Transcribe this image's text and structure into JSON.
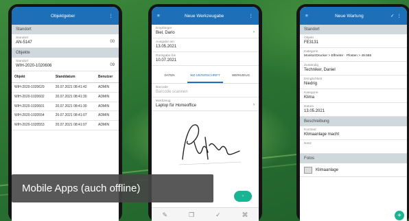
{
  "phone1": {
    "title": "Objektgeber",
    "sections": [
      "Standort",
      "Objekte"
    ],
    "fields": [
      {
        "label": "Standort",
        "value": "AN-5147",
        "right": "00"
      },
      {
        "label": "Standort",
        "value": "WIH-2020-1020606",
        "right": "09"
      }
    ],
    "columns": [
      "Objekt",
      "Standdatum",
      "Benutzer"
    ],
    "rows": [
      [
        "WIH-2020-1020629",
        "20.07.2021 08:41:42",
        "ADMIN"
      ],
      [
        "WIH-2020-1020602",
        "20.07.2021 08:41:30",
        "ADMIN"
      ],
      [
        "WIH-2020-1020601",
        "20.07.2021 08:41:30",
        "ADMIN"
      ],
      [
        "WIH-2020-1020554",
        "20.07.2021 08:41:07",
        "ADMIN"
      ],
      [
        "WIH-2020-1020553",
        "20.07.2021 08:41:07",
        "ADMIN"
      ]
    ]
  },
  "phone2": {
    "title": "Neue Werkzeugabe",
    "fields": [
      {
        "label": "Empfänger",
        "value": "Biel, Dario"
      },
      {
        "label": "Ausgabe am",
        "value": "13.05.2021"
      },
      {
        "label": "Rückgabe bis",
        "value": "10.07.2021"
      }
    ],
    "tabs": [
      "DATEN",
      "WZ-UNTERSCHRIFT",
      "WERKZEUG"
    ],
    "fields2": [
      {
        "label": "Barcode",
        "value": "Barcode scannen"
      },
      {
        "label": "Werkzeug",
        "value": "Laptop für Homeoffice"
      }
    ],
    "signature": "Pantra"
  },
  "phone3": {
    "title": "Neue Wartung",
    "sections": [
      "Standort",
      "Beschreibung",
      "Fotos"
    ],
    "fields": [
      {
        "label": "Objekt",
        "value": "FE3131"
      },
      {
        "label": "Kategorie",
        "value": "Monitor/Drucker > Elfmeter · Pfosten > 49.555"
      },
      {
        "label": "Zuständig",
        "value": "Techniker, Daniel"
      },
      {
        "label": "Dringlichkeit",
        "value": "Niedrig"
      },
      {
        "label": "Kategorie",
        "value": "Klima"
      },
      {
        "label": "Datum",
        "value": "13.05.2021"
      }
    ],
    "fields2": [
      {
        "label": "Kurztext",
        "value": "Klimaanlage macht"
      },
      {
        "label": "Notiz",
        "value": ""
      }
    ],
    "photo": "Klimaanlage"
  },
  "caption": "Mobile Apps (auch offline)"
}
